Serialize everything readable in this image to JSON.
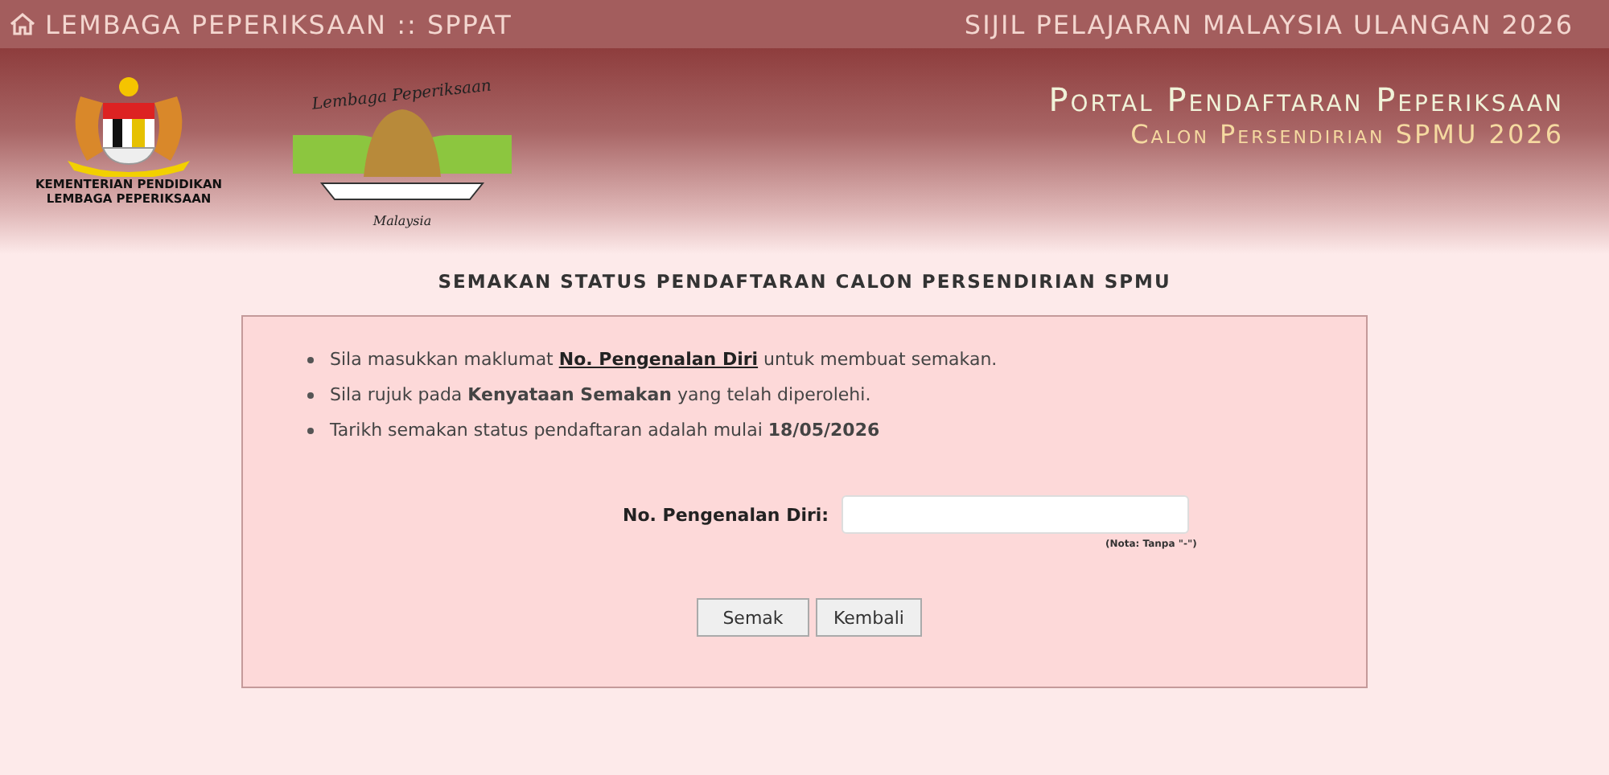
{
  "top_bar": {
    "left": "LEMBAGA PEPERIKSAAN :: SPPAT",
    "right": "SIJIL PELAJARAN MALAYSIA ULANGAN 2026"
  },
  "banner": {
    "ministry_lines": [
      "KEMENTERIAN PENDIDIKAN",
      "LEMBAGA PEPERIKSAAN"
    ],
    "logo_top": "Lembaga Peperiksaan",
    "logo_bottom": "Malaysia",
    "portal_title": "Portal Pendaftaran Peperiksaan",
    "portal_subtitle": "Calon Persendirian SPMU 2026"
  },
  "page_title": "SEMAKAN STATUS PENDAFTARAN CALON PERSENDIRIAN SPMU",
  "instructions": [
    [
      {
        "kind": "plain",
        "text": "Sila masukkan maklumat "
      },
      {
        "kind": "link",
        "text": "No. Pengenalan Diri"
      },
      {
        "kind": "plain",
        "text": " untuk membuat semakan."
      }
    ],
    [
      {
        "kind": "plain",
        "text": "Sila rujuk pada "
      },
      {
        "kind": "bold",
        "text": "Kenyataan Semakan"
      },
      {
        "kind": "plain",
        "text": " yang telah diperolehi."
      }
    ],
    [
      {
        "kind": "plain",
        "text": "Tarikh semakan status pendaftaran adalah mulai "
      },
      {
        "kind": "bold",
        "text": "18/05/2026"
      }
    ]
  ],
  "form": {
    "label": "No. Pengenalan Diri:",
    "note": "(Nota: Tanpa \"-\")"
  },
  "buttons": [
    "Semak",
    "Kembali"
  ]
}
